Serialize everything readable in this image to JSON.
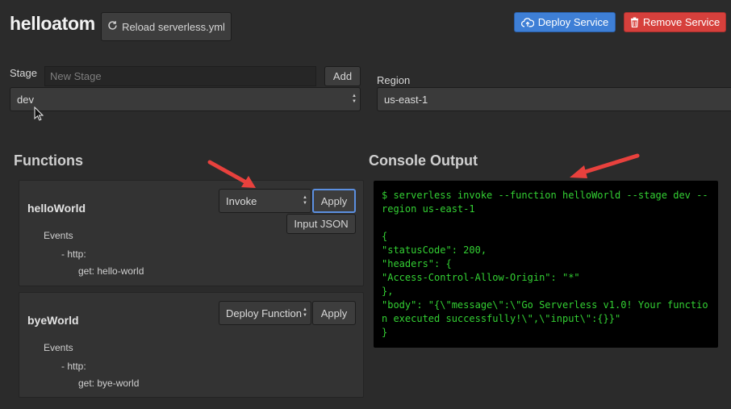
{
  "app": {
    "title": "helloatom"
  },
  "toolbar": {
    "reload_label": "Reload serverless.yml",
    "deploy_label": "Deploy Service",
    "remove_label": "Remove Service"
  },
  "stage": {
    "label": "Stage",
    "new_placeholder": "New Stage",
    "add_label": "Add",
    "selected": "dev"
  },
  "region": {
    "label": "Region",
    "selected": "us-east-1"
  },
  "functions": {
    "title": "Functions",
    "items": [
      {
        "name": "helloWorld",
        "action": "Invoke",
        "apply_label": "Apply",
        "input_json_label": "Input JSON",
        "events_label": "Events",
        "event_type": "- http:",
        "event_detail": "get: hello-world"
      },
      {
        "name": "byeWorld",
        "action": "Deploy Function",
        "apply_label": "Apply",
        "events_label": "Events",
        "event_type": "- http:",
        "event_detail": "get: bye-world"
      }
    ]
  },
  "console": {
    "title": "Console Output",
    "lines": [
      "$ serverless invoke --function helloWorld --stage dev --region us-east-1",
      "",
      "{",
      "\"statusCode\": 200,",
      "\"headers\": {",
      "\"Access-Control-Allow-Origin\": \"*\"",
      "},",
      "\"body\": \"{\\\"message\\\":\\\"Go Serverless v1.0! Your function executed successfully!\\\",\\\"input\\\":{}}\"",
      "}"
    ]
  },
  "colors": {
    "deploy": "#3e7fd6",
    "remove": "#d6403c",
    "console_text": "#33d033",
    "annotation_arrow": "#e8413d"
  }
}
